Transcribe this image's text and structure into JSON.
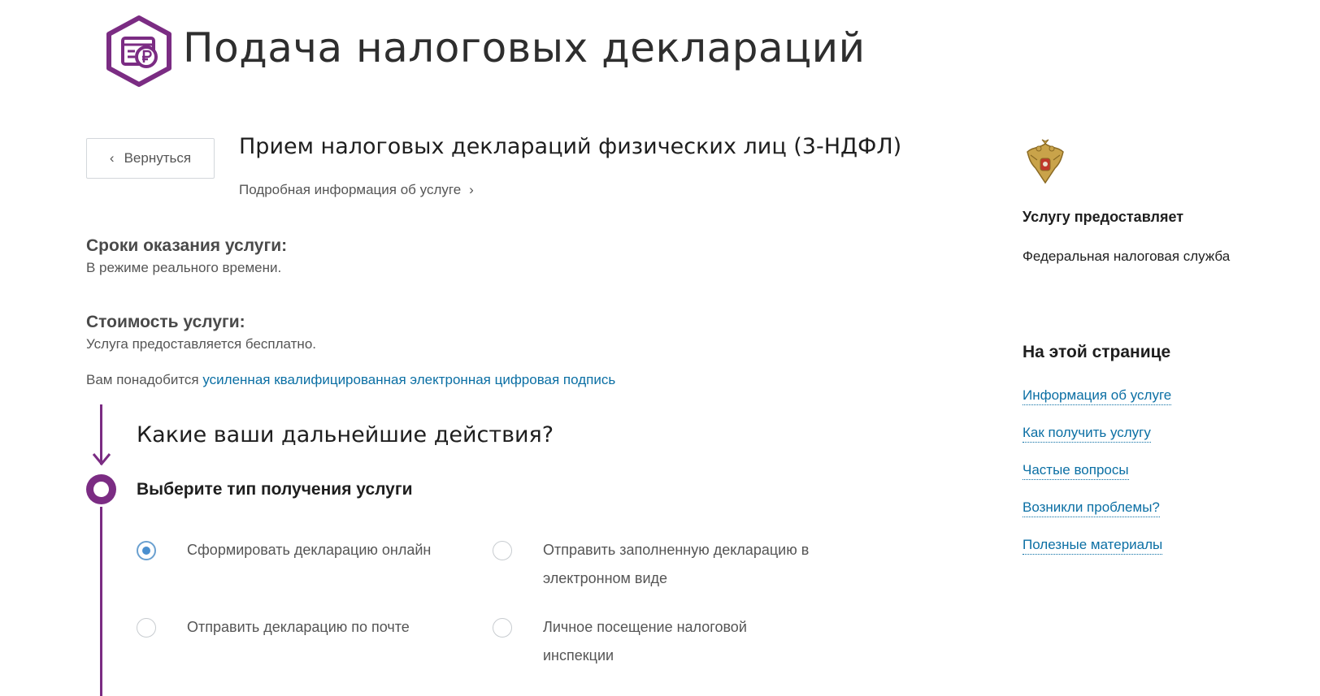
{
  "header": {
    "title": "Подача налоговых деклараций",
    "logo_icon": "ruble-document-icon",
    "logo_color": "#7b2c83"
  },
  "back_button": {
    "label": "Вернуться"
  },
  "service": {
    "title": "Прием налоговых деклараций физических лиц (3-НДФЛ)",
    "info_link": "Подробная информация об услуге"
  },
  "terms": {
    "label": "Сроки оказания услуги:",
    "value": "В режиме реального времени."
  },
  "cost": {
    "label": "Стоимость услуги:",
    "value": "Услуга предоставляется бесплатно."
  },
  "requirement": {
    "prefix": "Вам понадобится",
    "link": "усиленная квалифицированная электронная цифровая подпись"
  },
  "steps": {
    "title": "Какие ваши дальнейшие действия?",
    "choose_title": "Выберите тип получения услуги",
    "accent_color": "#7b2c83",
    "options": [
      {
        "label": "Сформировать декларацию онлайн",
        "checked": true
      },
      {
        "label": "Отправить заполненную декларацию в электронном виде",
        "checked": false
      },
      {
        "label": "Отправить декларацию по почте",
        "checked": false
      },
      {
        "label": "Личное посещение налоговой инспекции",
        "checked": false
      }
    ]
  },
  "sidebar": {
    "emblem_icon": "russian-coat-of-arms-icon",
    "provider_heading": "Услугу предоставляет",
    "provider_name": "Федеральная налоговая служба",
    "onpage_heading": "На этой странице",
    "links": [
      "Информация об услуге",
      "Как получить услугу",
      "Частые вопросы",
      "Возникли проблемы?",
      "Полезные материалы"
    ],
    "link_color": "#0b6fa4"
  }
}
